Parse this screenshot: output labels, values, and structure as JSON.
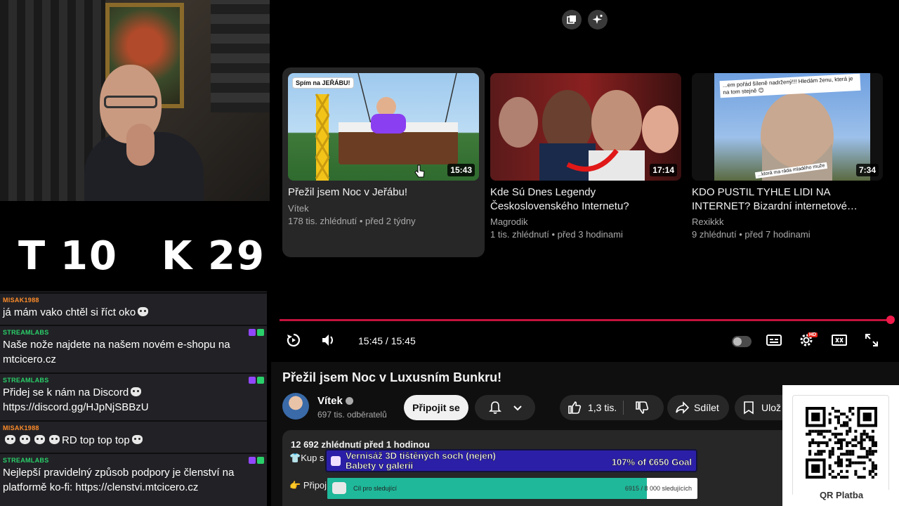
{
  "scoreboard": {
    "t_label": "T",
    "t_value": "10",
    "k_label": "K",
    "k_value": "29"
  },
  "chat": [
    {
      "user": "MISAK1988",
      "text": "já mám vako chtěl si říct oko"
    },
    {
      "user": "STREAMLABS",
      "text": "Naše nože najdete na našem novém e-shopu na mtcicero.cz"
    },
    {
      "user": "STREAMLABS",
      "text": "Přidej se k nám na Discord",
      "text2": "https://discord.gg/HJpNjSBBzU"
    },
    {
      "user": "MISAK1988",
      "text": "RD top top top"
    },
    {
      "user": "STREAMLABS",
      "text": "Nejlepší pravidelný způsob podpory je členství na platformě ko-fi: https://clenstvi.mtcicero.cz"
    }
  ],
  "player": {
    "end_cards": [
      {
        "title": "Přežil jsem Noc v Jeřábu!",
        "channel": "Vítek",
        "meta": "178 tis. zhlédnutí • před 2 týdny",
        "duration": "15:43",
        "thumb_caption": "Spím na JEŘÁBU!"
      },
      {
        "title": "Kde Sú Dnes Legendy Československého Internetu?",
        "channel": "Magrodik",
        "meta": "1 tis. zhlédnutí • před 3 hodinami",
        "duration": "17:14"
      },
      {
        "title": "KDO PUSTIL TYHLE LIDI NA INTERNET? Bizardní internetové…",
        "channel": "Rexikkk",
        "meta": "9 zhlédnutí • před 7 hodinami",
        "duration": "7:34",
        "thumb_caption": "...em pořád šíleně nadržený!!! Hledám ženu, která je na tom stejně 😊",
        "thumb_caption2": "...ktorá ma ráda mladého muže"
      }
    ],
    "time": "15:45 / 15:45",
    "progress_fraction": 1.0,
    "hd_badge": "HD"
  },
  "video": {
    "title": "Přežil jsem Noc v Luxusním Bunkru!",
    "channel": "Vítek",
    "subscribers": "697 tis. odběratelů",
    "join_label": "Připojit se",
    "likes": "1,3 tis.",
    "share_label": "Sdílet",
    "save_label": "Ulož",
    "stats": "12 692 zhlédnutí  před 1 hodinou",
    "desc_line1": "Kup s",
    "desc_line2": "Připoj"
  },
  "overlays": {
    "goal1_title": "Vernisáž 3D tištěných soch (nejen)",
    "goal1_title2": "Babety v galerii",
    "goal1_progress": "107% of €650 Goal",
    "goal2_title": "Cíl pro sledující",
    "goal2_progress": "6915 / 8 000 sledujících",
    "goal2_fraction": 0.864,
    "qr_label": "QR Platba"
  },
  "colors": {
    "accent_red": "#f01a4a",
    "goal1_bg": "#2b1fa8",
    "goal2_fill": "#1fb89a"
  }
}
